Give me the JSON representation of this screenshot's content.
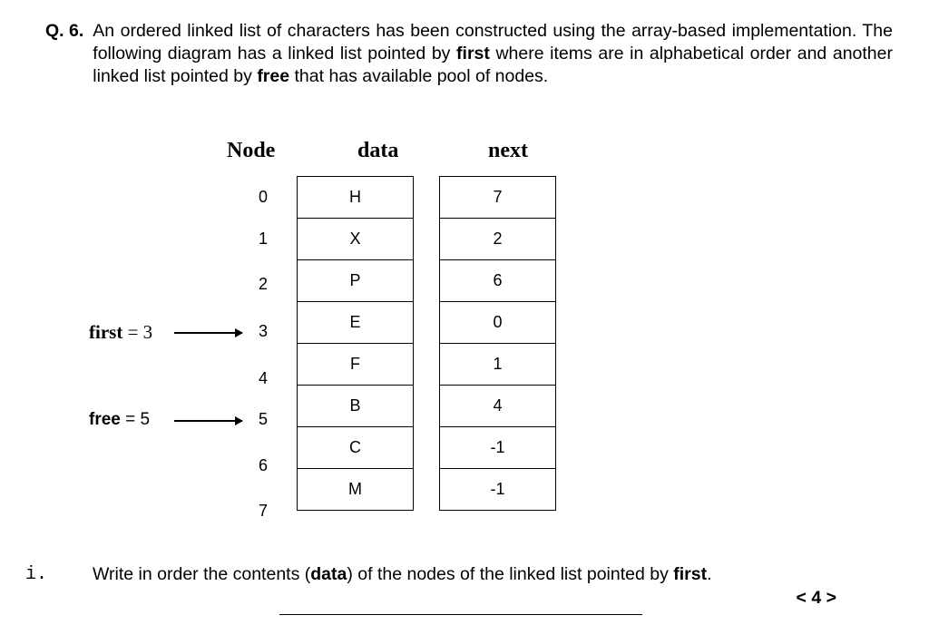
{
  "question": {
    "label": "Q. 6.",
    "text_before_first": "An ordered linked list of characters has been constructed using the array-based implementation. The following diagram has a linked list pointed by ",
    "bold_first": "first",
    "text_mid": " where items are in alphabetical order and another linked list pointed by ",
    "bold_free": "free",
    "text_after": " that has available pool of nodes."
  },
  "headers": {
    "node": "Node",
    "data": "data",
    "next": "next"
  },
  "pointers": {
    "first_label": "first",
    "first_eq": " = 3",
    "free_label": "free",
    "free_eq": " = 5"
  },
  "rows": [
    {
      "idx": "0",
      "data": "H",
      "next": "7"
    },
    {
      "idx": "1",
      "data": "X",
      "next": "2"
    },
    {
      "idx": "2",
      "data": "P",
      "next": "6"
    },
    {
      "idx": "3",
      "data": "E",
      "next": "0"
    },
    {
      "idx": "4",
      "data": "F",
      "next": "1"
    },
    {
      "idx": "5",
      "data": "B",
      "next": "4"
    },
    {
      "idx": "6",
      "data": "C",
      "next": "-1"
    },
    {
      "idx": "7",
      "data": "M",
      "next": "-1"
    }
  ],
  "part_i": {
    "label": "i.",
    "text_before": "Write in order the contents (",
    "bold_data": "data",
    "text_mid": ") of the nodes of the linked list pointed by ",
    "bold_first": "first",
    "period": ".",
    "marks": "< 4 >"
  }
}
